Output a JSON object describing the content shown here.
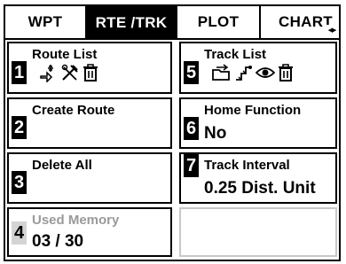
{
  "tabs": [
    {
      "label": "WPT",
      "selected": false
    },
    {
      "label": "RTE /TRK",
      "selected": true
    },
    {
      "label": "PLOT",
      "selected": false
    },
    {
      "label": "CHART",
      "selected": false
    }
  ],
  "tab_scroll_arrows": "◀▶",
  "menu": {
    "route_list": {
      "number": "1",
      "label": "Route List",
      "icons": [
        "new-route-icon",
        "edit-tools-icon",
        "delete-icon"
      ]
    },
    "create_route": {
      "number": "2",
      "label": "Create Route"
    },
    "delete_all": {
      "number": "3",
      "label": "Delete All"
    },
    "used_memory": {
      "number": "4",
      "label": "Used Memory",
      "value": "03 / 30",
      "disabled": true
    },
    "track_list": {
      "number": "5",
      "label": "Track List",
      "icons": [
        "open-folder-icon",
        "track-route-icon",
        "view-eye-icon",
        "delete-icon"
      ]
    },
    "home_function": {
      "number": "6",
      "label": "Home Function",
      "value": "No"
    },
    "track_interval": {
      "number": "7",
      "label": "Track Interval",
      "value": "0.25 Dist. Unit"
    }
  }
}
